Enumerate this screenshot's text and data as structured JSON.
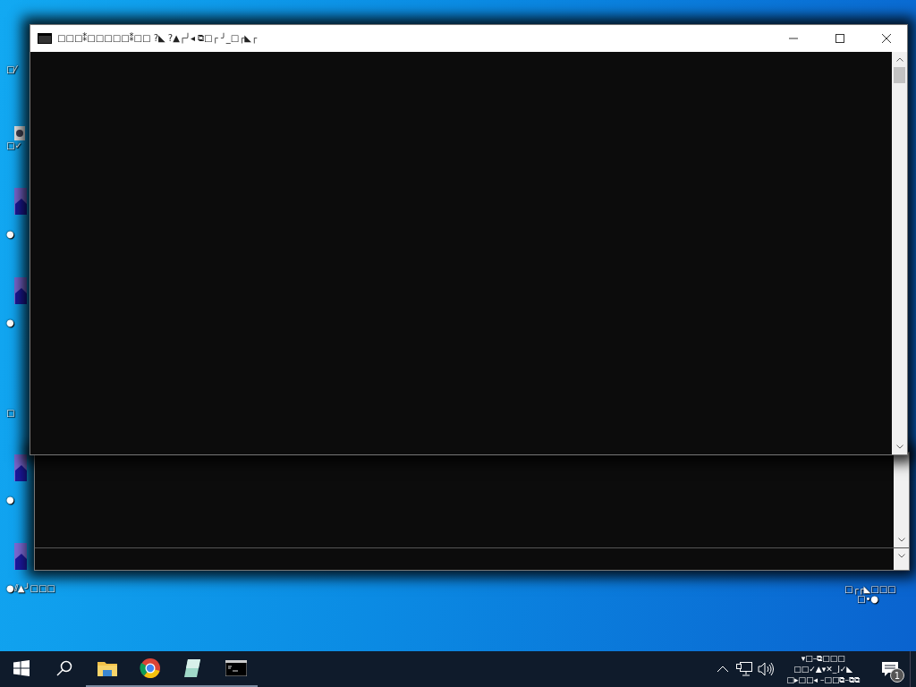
{
  "desktop": {
    "icons": [
      {
        "kind": "none",
        "label": "□⁄"
      },
      {
        "kind": "file",
        "label": "□✓"
      },
      {
        "kind": "app",
        "label": "●"
      },
      {
        "kind": "app",
        "label": "●"
      },
      {
        "kind": "none",
        "label": "□"
      },
      {
        "kind": "app",
        "label": "●"
      },
      {
        "kind": "app",
        "label": "●⫽▲╯□□□"
      }
    ],
    "right_label": [
      "□┌┌◣□□□",
      "□•●"
    ]
  },
  "window": {
    "title": "□□□⁑□□□□□⁑□□ ?◣ ?▲┌╯◂ ⧉□┌ ╯_□┌◣┌"
  },
  "taskbar": {
    "apps": [
      {
        "kind": "folder",
        "running": true
      },
      {
        "kind": "browser",
        "running": true
      },
      {
        "kind": "notepad",
        "running": true
      },
      {
        "kind": "console",
        "running": true
      }
    ],
    "clock": [
      "▾□–⧉□□□",
      "□□✓▲▾✕_⌋✓◣",
      "□▸□□◂ –□□⧉–⧉⧉"
    ],
    "notifications": "1"
  }
}
